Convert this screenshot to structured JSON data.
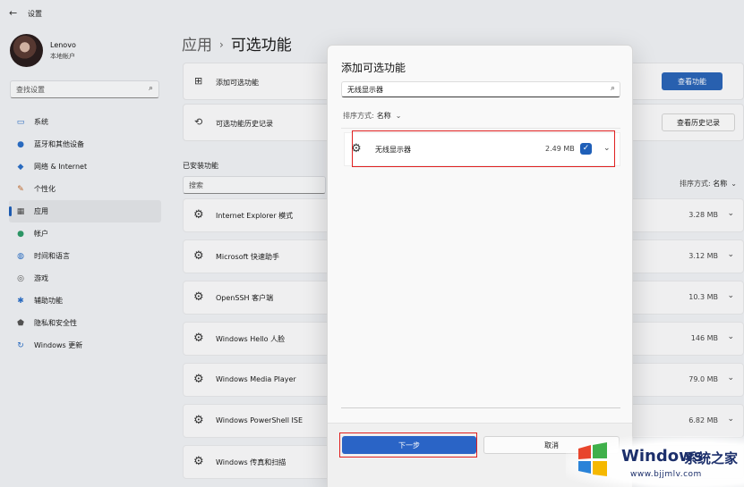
{
  "titlebar": {
    "back_icon": "back-arrow-icon",
    "title": "设置"
  },
  "user": {
    "name": "Lenovo",
    "account_type": "本地帐户"
  },
  "sidebar": {
    "search_placeholder": "查找设置",
    "items": [
      {
        "label": "系统",
        "icon": "monitor-icon",
        "color": "#2b6fc7"
      },
      {
        "label": "蓝牙和其他设备",
        "icon": "bluetooth-icon",
        "color": "#2b6fc7"
      },
      {
        "label": "网络 & Internet",
        "icon": "wifi-icon",
        "color": "#2b6fc7"
      },
      {
        "label": "个性化",
        "icon": "brush-icon",
        "color": "#c56a2a"
      },
      {
        "label": "应用",
        "icon": "apps-icon",
        "color": "#4a4a4a",
        "active": true
      },
      {
        "label": "帐户",
        "icon": "person-icon",
        "color": "#2e9c6a"
      },
      {
        "label": "时间和语言",
        "icon": "globe-clock-icon",
        "color": "#2b6fc7"
      },
      {
        "label": "游戏",
        "icon": "gamepad-icon",
        "color": "#555555"
      },
      {
        "label": "辅助功能",
        "icon": "accessibility-icon",
        "color": "#2b6fc7"
      },
      {
        "label": "隐私和安全性",
        "icon": "shield-icon",
        "color": "#555555"
      },
      {
        "label": "Windows 更新",
        "icon": "update-icon",
        "color": "#2b6fc7"
      }
    ]
  },
  "main": {
    "breadcrumb": {
      "parent": "应用",
      "current": "可选功能"
    },
    "add_card": {
      "label": "添加可选功能",
      "button": "查看功能"
    },
    "history_card": {
      "label": "可选功能历史记录",
      "button": "查看历史记录"
    },
    "installed": {
      "title": "已安装功能",
      "search_placeholder": "搜索",
      "sort_label": "排序方式:",
      "sort_value": "名称",
      "items": [
        {
          "name": "Internet Explorer 模式",
          "size": "3.28 MB"
        },
        {
          "name": "Microsoft 快速助手",
          "size": "3.12 MB"
        },
        {
          "name": "OpenSSH 客户端",
          "size": "10.3 MB"
        },
        {
          "name": "Windows Hello 人脸",
          "size": "146 MB"
        },
        {
          "name": "Windows Media Player",
          "size": "79.0 MB"
        },
        {
          "name": "Windows PowerShell ISE",
          "size": "6.82 MB"
        },
        {
          "name": "Windows 传真和扫描",
          "size": ""
        }
      ]
    }
  },
  "dialog": {
    "title": "添加可选功能",
    "search_value": "无线显示器",
    "sort_label": "排序方式:",
    "sort_value": "名称",
    "result": {
      "name": "无线显示器",
      "size": "2.49 MB",
      "checked": true
    },
    "next_button": "下一步",
    "cancel_button": "取消"
  },
  "watermark": {
    "brand": "Windows",
    "suffix": "系统之家",
    "url": "www.bjjmlv.com"
  },
  "colors": {
    "accent": "#2a64b7",
    "highlight": "#e02020"
  }
}
